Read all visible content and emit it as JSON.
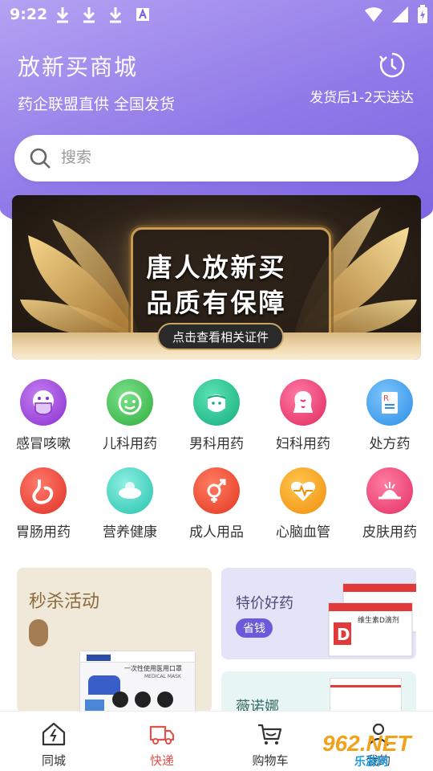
{
  "status_bar": {
    "time": "9:22"
  },
  "header": {
    "title": "放新买商城",
    "tagline": "药企联盟直供 全国发货",
    "delivery_note": "发货后1-2天送达"
  },
  "search": {
    "placeholder": "搜索"
  },
  "banner": {
    "line1": "唐人放新买",
    "line2": "品质有保障",
    "button": "点击查看相关证件"
  },
  "categories": [
    {
      "label": "感冒咳嗽",
      "icon": "mask-face-icon",
      "color": "#9b3fd6"
    },
    {
      "label": "儿科用药",
      "icon": "child-face-icon",
      "color": "#3bc24a"
    },
    {
      "label": "男科用药",
      "icon": "man-face-icon",
      "color": "#1cc08e"
    },
    {
      "label": "妇科用药",
      "icon": "woman-face-icon",
      "color": "#f0427a"
    },
    {
      "label": "处方药",
      "icon": "prescription-icon",
      "color": "#3aa1ee"
    },
    {
      "label": "胃肠用药",
      "icon": "stomach-icon",
      "color": "#f0433a"
    },
    {
      "label": "营养健康",
      "icon": "nutrition-icon",
      "color": "#35d4c0"
    },
    {
      "label": "成人用品",
      "icon": "gender-icon",
      "color": "#f2503a"
    },
    {
      "label": "心脑血管",
      "icon": "heart-pulse-icon",
      "color": "#f7a21c"
    },
    {
      "label": "皮肤用药",
      "icon": "skin-icon",
      "color": "#f0426e"
    }
  ],
  "promos": {
    "flash_sale": {
      "title": "秒杀活动",
      "product_text": "一次性使用医用口罩",
      "product_sub": "MEDICAL MASK"
    },
    "special_price": {
      "title": "特价好药",
      "tag": "省钱",
      "product_text": "维生素D滴剂"
    },
    "brand": {
      "title": "薇诺娜"
    }
  },
  "bottom_nav": [
    {
      "label": "同城",
      "icon": "lightning-house-icon",
      "active": false
    },
    {
      "label": "快递",
      "icon": "truck-icon",
      "active": true
    },
    {
      "label": "购物车",
      "icon": "cart-icon",
      "active": false
    },
    {
      "label": "我的",
      "icon": "user-icon",
      "active": false
    }
  ],
  "watermark": {
    "text": "962.NET",
    "sub": "乐游网"
  }
}
